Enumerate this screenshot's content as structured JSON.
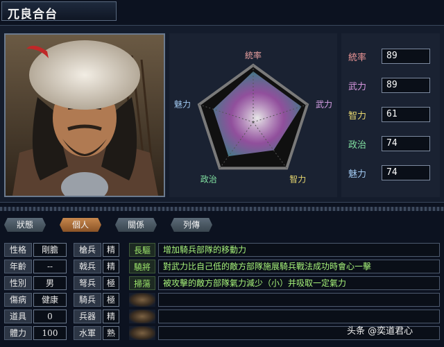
{
  "header": {
    "name": "兀良合台"
  },
  "radar": {
    "labels": {
      "command": "統率",
      "force": "武力",
      "intel": "智力",
      "politics": "政治",
      "charm": "魅力"
    },
    "values": {
      "command": 89,
      "force": 89,
      "intel": 61,
      "politics": 74,
      "charm": 74
    },
    "max": 100,
    "label_colors": {
      "command": "#e8a0a0",
      "force": "#d8a0e8",
      "intel": "#e8d870",
      "politics": "#80e0a0",
      "charm": "#a0c8f0"
    }
  },
  "stats": [
    {
      "label": "統率",
      "value": "89",
      "color": "#f09898"
    },
    {
      "label": "武力",
      "value": "89",
      "color": "#d898e0"
    },
    {
      "label": "智力",
      "value": "61",
      "color": "#e8d870"
    },
    {
      "label": "政治",
      "value": "74",
      "color": "#80e0a0"
    },
    {
      "label": "魅力",
      "value": "74",
      "color": "#a0c8f0"
    }
  ],
  "tabs": [
    {
      "label": "狀態",
      "active": false
    },
    {
      "label": "個人",
      "active": true
    },
    {
      "label": "關係",
      "active": false
    },
    {
      "label": "列傳",
      "active": false
    }
  ],
  "personal": [
    {
      "label": "性格",
      "value": "剛膽"
    },
    {
      "label": "年齡",
      "value": "--"
    },
    {
      "label": "性別",
      "value": "男"
    },
    {
      "label": "傷病",
      "value": "健康"
    },
    {
      "label": "道具",
      "value": "0"
    },
    {
      "label": "體力",
      "value": "100"
    }
  ],
  "aptitudes": [
    {
      "label": "槍兵",
      "value": "精"
    },
    {
      "label": "戟兵",
      "value": "精"
    },
    {
      "label": "弩兵",
      "value": "極"
    },
    {
      "label": "騎兵",
      "value": "極"
    },
    {
      "label": "兵器",
      "value": "精"
    },
    {
      "label": "水軍",
      "value": "熟"
    }
  ],
  "skills": [
    {
      "name": "長驅",
      "desc": "增加騎兵部隊的移動力"
    },
    {
      "name": "驍將",
      "desc": "對武力比自己低的敵方部隊施展騎兵戰法成功時會心一擊"
    },
    {
      "name": "掃蕩",
      "desc": "被攻擊的敵方部隊氣力減少（小）并吸取一定氣力"
    },
    {
      "name": "",
      "desc": ""
    },
    {
      "name": "",
      "desc": ""
    },
    {
      "name": "",
      "desc": ""
    }
  ],
  "watermark": "头条 @奕道君心"
}
